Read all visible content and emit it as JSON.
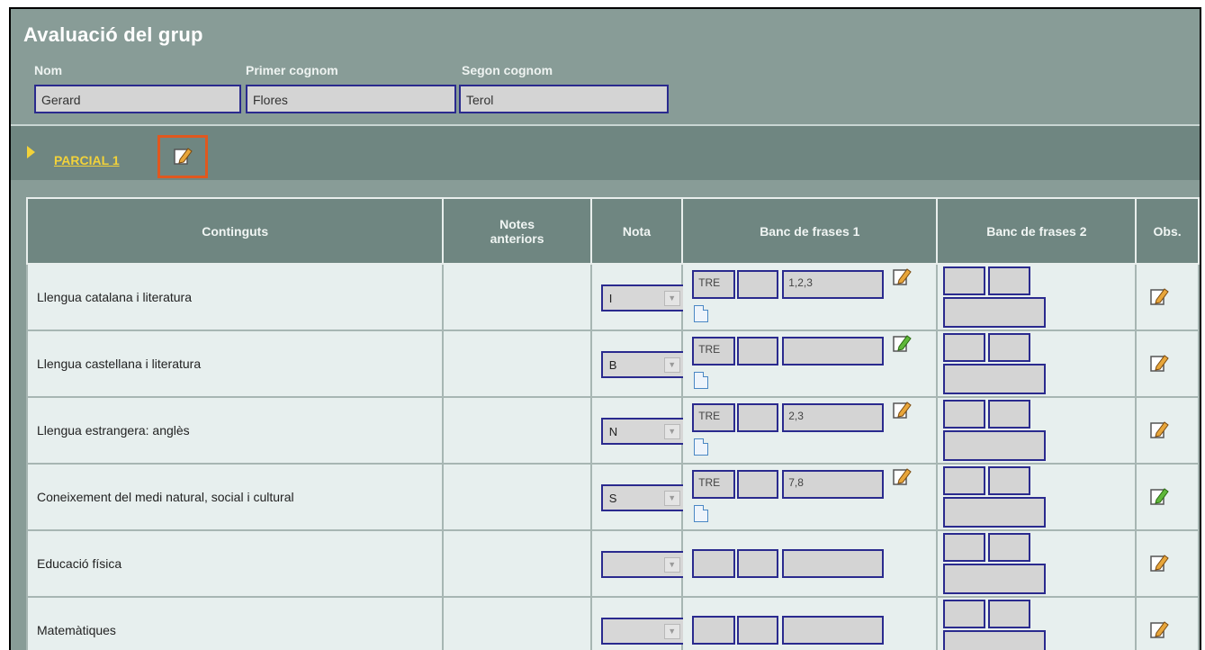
{
  "header": {
    "title": "Avaluació del grup",
    "nom_label": "Nom",
    "primer_label": "Primer cognom",
    "segon_label": "Segon cognom",
    "nom_value": "Gerard",
    "primer_value": "Flores",
    "segon_value": "Terol"
  },
  "section": {
    "label": "PARCIAL 1"
  },
  "table": {
    "headers": {
      "continguts": "Continguts",
      "notes_line1": "Notes",
      "notes_line2": "anteriors",
      "nota": "Nota",
      "banc1": "Banc de frases 1",
      "banc2": "Banc de frases 2",
      "obs": "Obs."
    },
    "rows": [
      {
        "subject": "Llengua catalana i literatura",
        "nota": "I",
        "code": "TRE",
        "frases": "1,2,3"
      },
      {
        "subject": "Llengua castellana i literatura",
        "nota": "B",
        "code": "TRE",
        "frases": ""
      },
      {
        "subject": "Llengua estrangera: anglès",
        "nota": "N",
        "code": "TRE",
        "frases": "2,3"
      },
      {
        "subject": "Coneixement del medi natural, social i cultural",
        "nota": "S",
        "code": "TRE",
        "frases": "7,8"
      },
      {
        "subject": "Educació física",
        "nota": "",
        "code": "",
        "frases": ""
      },
      {
        "subject": "Matemàtiques",
        "nota": "",
        "code": "",
        "frases": ""
      }
    ]
  },
  "colors": {
    "header_bg": "#889c97",
    "bar_bg": "#6f8681",
    "accent_yellow": "#f2d23a",
    "highlight": "#e0581f",
    "cell_bg": "#e7efee"
  },
  "icons": {
    "edit": "pencil-paper-icon",
    "edit_done": "green-pencil-paper-icon",
    "doc": "document-icon"
  }
}
